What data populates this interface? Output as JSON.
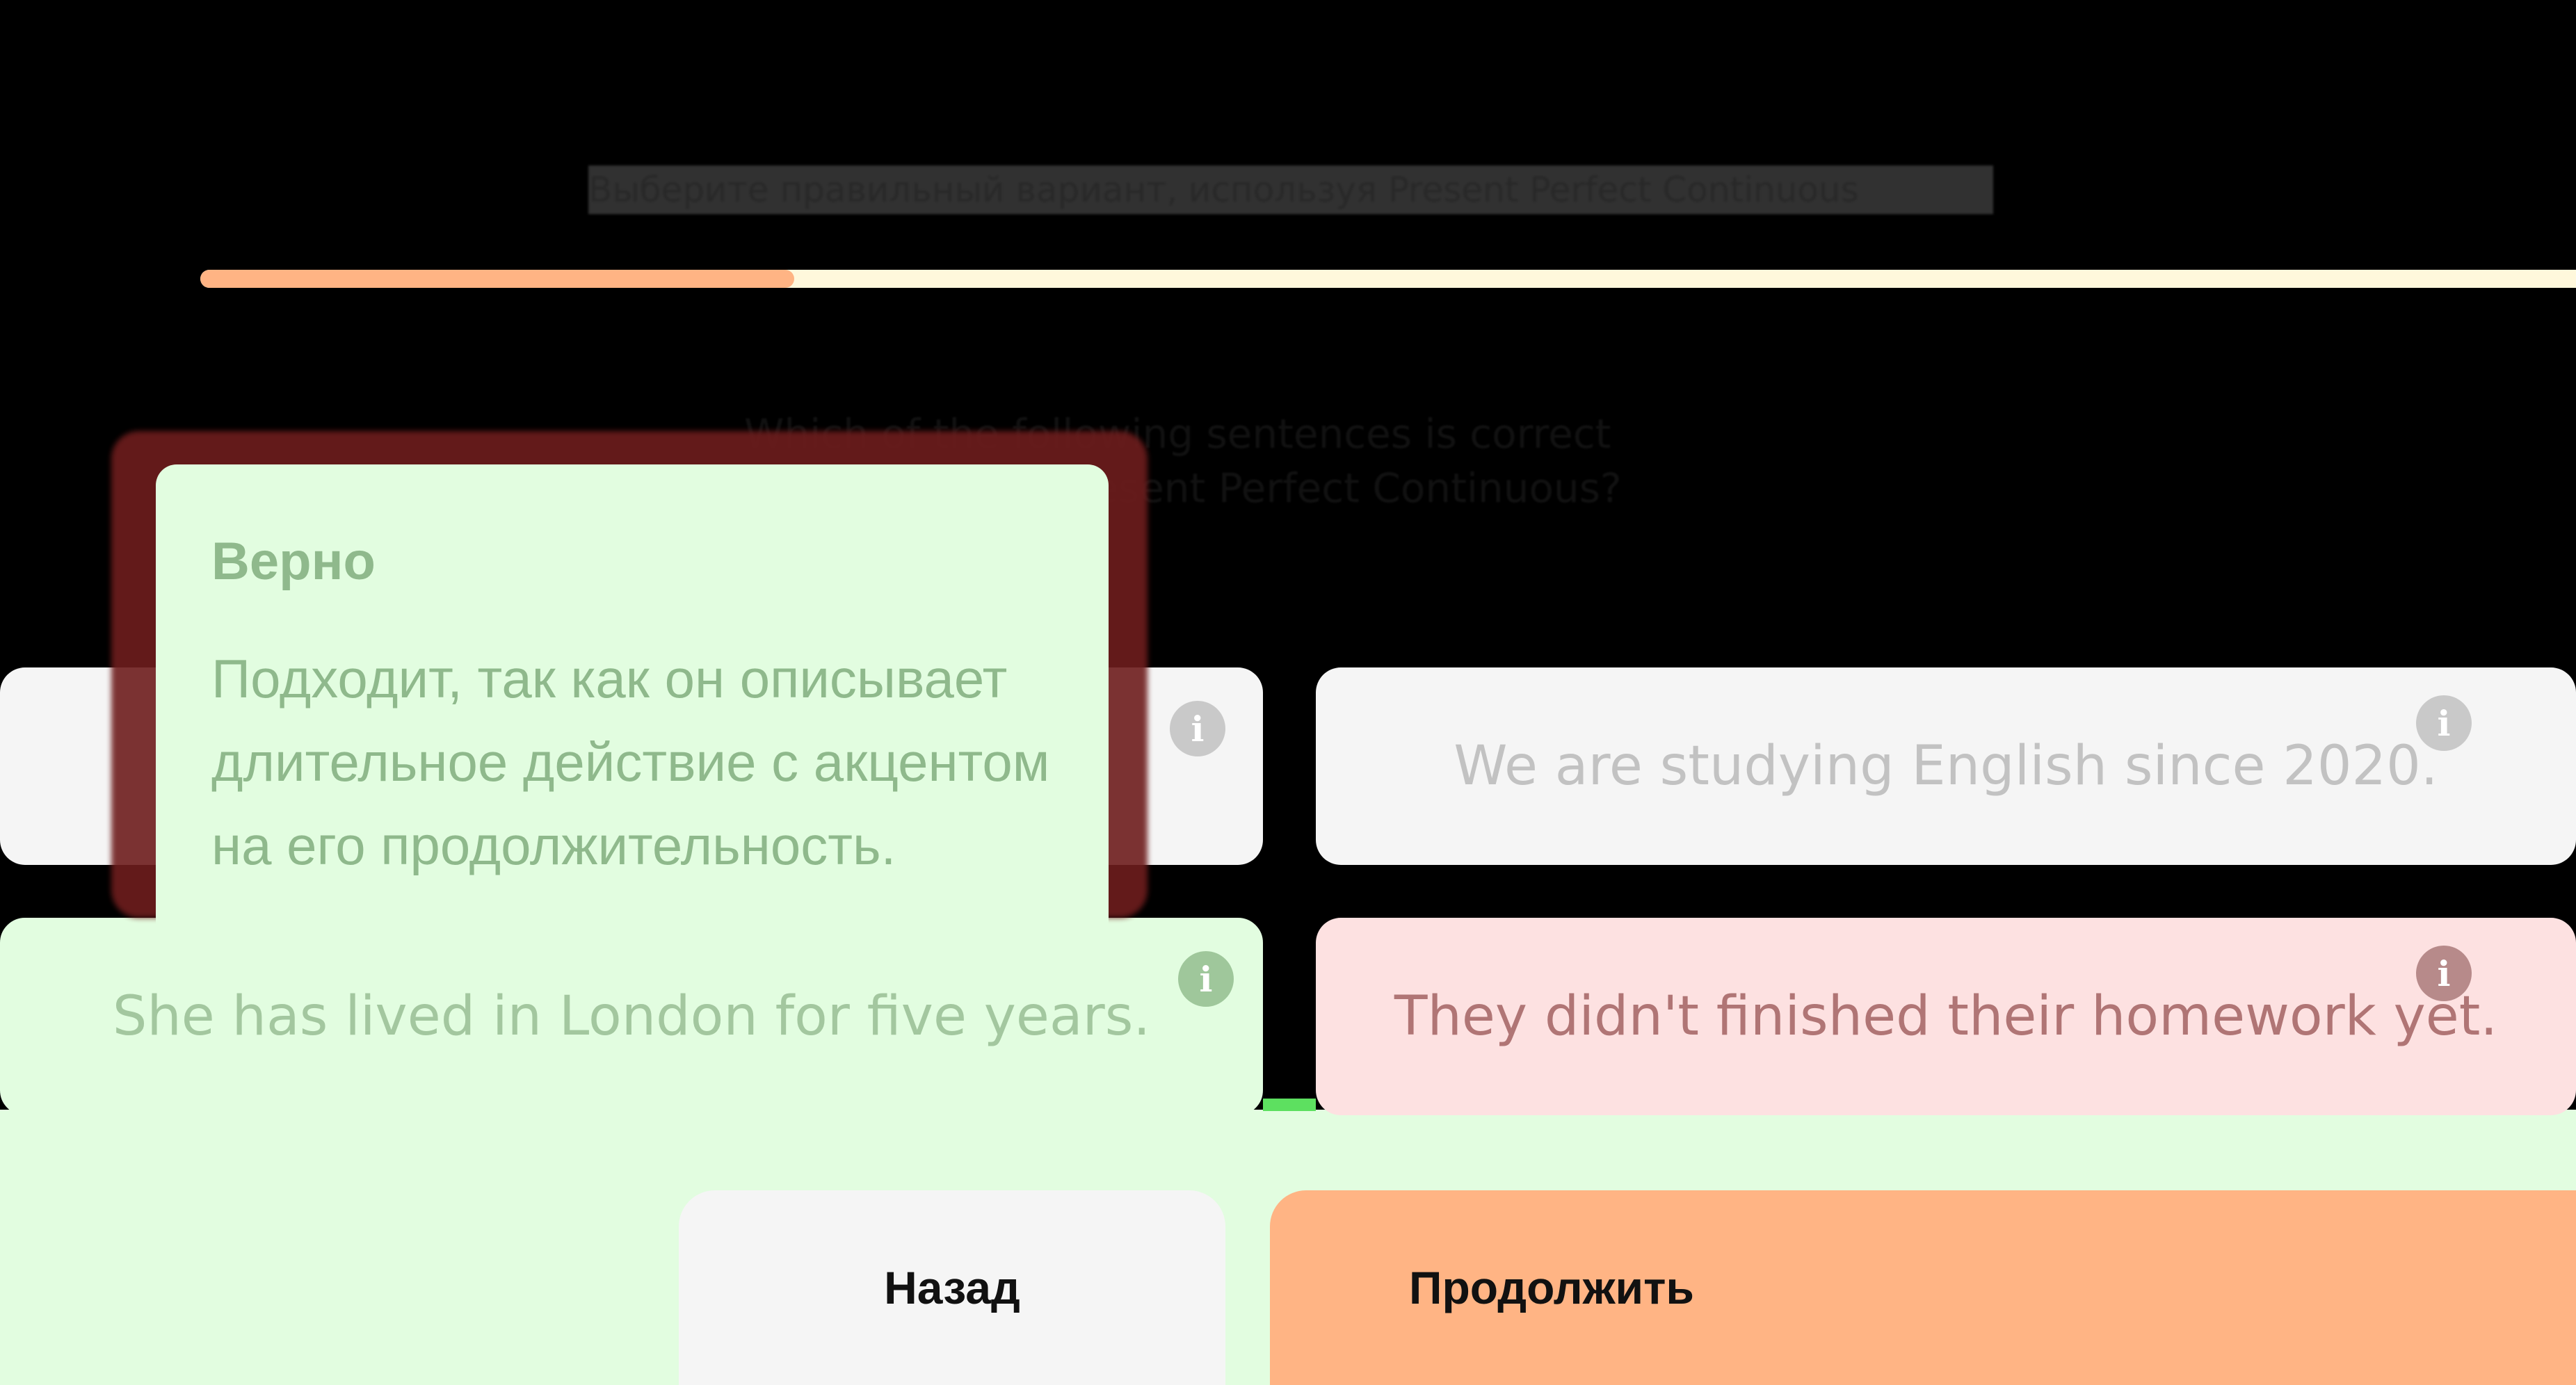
{
  "header": {
    "subtitle": "Выберите правильный вариант, используя Present Perfect Continuous",
    "progress": 0.25
  },
  "question": {
    "text_line1": "Which of the following sentences is correct",
    "text_line2": "in terms of the Present Perfect Continuous?"
  },
  "answers": [
    {
      "label": ""
    },
    {
      "label": "We are studying English since 2020."
    },
    {
      "label": "She has lived in London for five years."
    },
    {
      "label": "They didn't finished their homework yet."
    }
  ],
  "info_icon": "info-icon",
  "tooltip": {
    "title": "Верно",
    "text": "Подходит, так как он описывает длительное действие с акцентом на его продолжительность."
  },
  "buttons": {
    "back": "Назад",
    "next": "Продолжить"
  },
  "colors": {
    "accent": "#ffb484",
    "progress_track": "#fff8dc",
    "correct_bg": "#e2fde0",
    "wrong_bg": "#fde1e1",
    "neutral_bg": "#f5f5f5"
  }
}
